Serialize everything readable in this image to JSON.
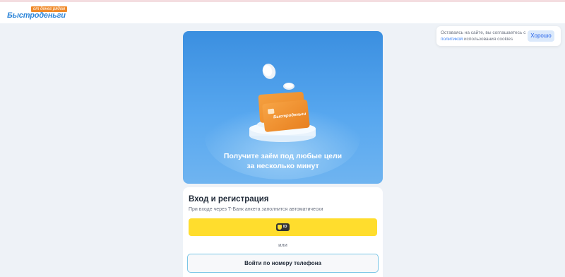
{
  "header": {
    "logo_tag": "от денег рядом",
    "logo_text": "Быстроденьги"
  },
  "cookie_banner": {
    "text_before": "Оставаясь на сайте, вы соглашаетесь с ",
    "link": "политикой",
    "text_after": " использования cookies",
    "accept_button": "Хорошо"
  },
  "hero": {
    "card_brand": "Быстроденьги",
    "title_line1": "Получите заём под любые цели",
    "title_line2": "за несколько минут"
  },
  "auth": {
    "title": "Вход и регистрация",
    "subtitle": "При входе через Т-Банк анкета заполнится автоматически",
    "tbank_button_badge": "ID",
    "divider": "или",
    "phone_button": "Войти по номеру телефона"
  },
  "colors": {
    "accent_blue": "#2f86d8",
    "tbank_yellow": "#ffdd2d",
    "card_orange": "#f08a2a",
    "phone_button_border": "#7cc6e6"
  }
}
